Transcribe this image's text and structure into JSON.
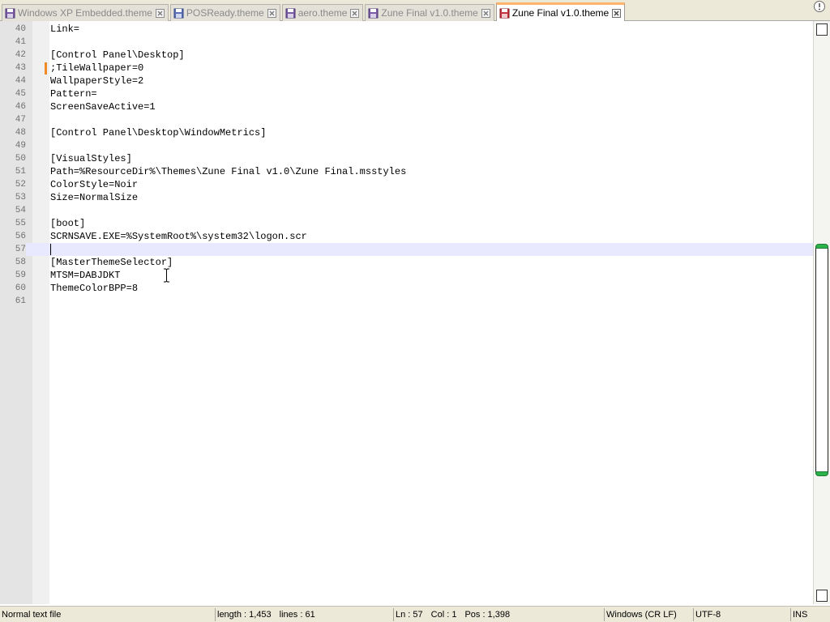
{
  "tabs": [
    {
      "label": "Windows XP Embedded.theme",
      "active": false,
      "icon_color": "#7b5aa6"
    },
    {
      "label": "POSReady.theme",
      "active": false,
      "icon_color": "#5a6fb8"
    },
    {
      "label": "aero.theme",
      "active": false,
      "icon_color": "#7b5aa6"
    },
    {
      "label": "Zune Final v1.0.theme",
      "active": false,
      "icon_color": "#7b5aa6"
    },
    {
      "label": "Zune Final v1.0.theme",
      "active": true,
      "icon_color": "#c8323c"
    }
  ],
  "editor": {
    "current_line": 57,
    "changed_line": 43,
    "lines": [
      {
        "n": "40",
        "text": "Link="
      },
      {
        "n": "41",
        "text": ""
      },
      {
        "n": "42",
        "text": "[Control Panel\\Desktop]"
      },
      {
        "n": "43",
        "text": ";TileWallpaper=0"
      },
      {
        "n": "44",
        "text": "WallpaperStyle=2"
      },
      {
        "n": "45",
        "text": "Pattern="
      },
      {
        "n": "46",
        "text": "ScreenSaveActive=1"
      },
      {
        "n": "47",
        "text": ""
      },
      {
        "n": "48",
        "text": "[Control Panel\\Desktop\\WindowMetrics]"
      },
      {
        "n": "49",
        "text": ""
      },
      {
        "n": "50",
        "text": "[VisualStyles]"
      },
      {
        "n": "51",
        "text": "Path=%ResourceDir%\\Themes\\Zune Final v1.0\\Zune Final.msstyles"
      },
      {
        "n": "52",
        "text": "ColorStyle=Noir"
      },
      {
        "n": "53",
        "text": "Size=NormalSize"
      },
      {
        "n": "54",
        "text": ""
      },
      {
        "n": "55",
        "text": "[boot]"
      },
      {
        "n": "56",
        "text": "SCRNSAVE.EXE=%SystemRoot%\\system32\\logon.scr"
      },
      {
        "n": "57",
        "text": ""
      },
      {
        "n": "58",
        "text": "[MasterThemeSelector]"
      },
      {
        "n": "59",
        "text": "MTSM=DABJDKT"
      },
      {
        "n": "60",
        "text": "ThemeColorBPP=8"
      },
      {
        "n": "61",
        "text": ""
      }
    ]
  },
  "status": {
    "file_type": "Normal text file",
    "length": "length : 1,453",
    "lines": "lines : 61",
    "ln": "Ln : 57",
    "col": "Col : 1",
    "pos": "Pos : 1,398",
    "eol": "Windows (CR LF)",
    "encoding": "UTF-8",
    "mode": "INS"
  },
  "colors": {
    "current_line_bg": "#e8e8ff",
    "active_tab_accent": "#ffb36b",
    "change_marker": "#f08a24",
    "scroll_thumb_cap": "#2ab34a"
  }
}
